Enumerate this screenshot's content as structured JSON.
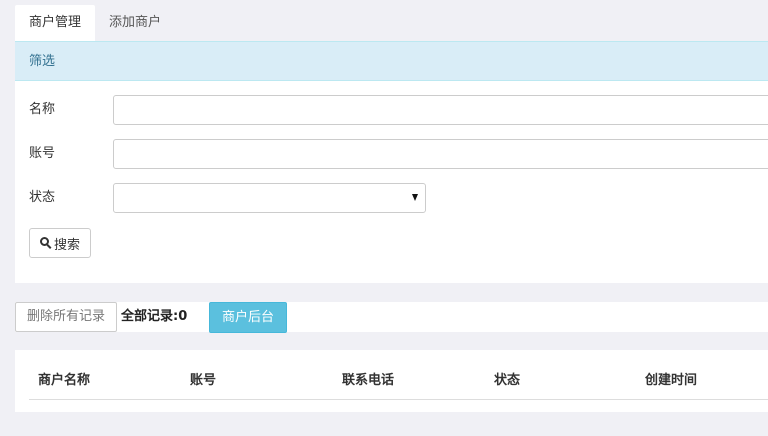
{
  "tabs": [
    {
      "label": "商户管理",
      "active": true
    },
    {
      "label": "添加商户",
      "active": false
    }
  ],
  "filter": {
    "heading": "筛选",
    "fields": {
      "name_label": "名称",
      "name_value": "",
      "account_label": "账号",
      "account_value": "",
      "status_label": "状态",
      "status_value": ""
    },
    "search_label": "搜索",
    "search_icon": "search-icon"
  },
  "actions": {
    "delete_all_label": "删除所有记录",
    "record_count_text": "全部记录:0",
    "merchant_backend_label": "商户后台"
  },
  "table": {
    "columns": [
      "商户名称",
      "账号",
      "联系电话",
      "状态",
      "创建时间"
    ],
    "rows": []
  },
  "colors": {
    "page_bg": "#f0f0f5",
    "heading_bg": "#d9edf7",
    "heading_text": "#31708f",
    "info_button": "#5bc0de"
  }
}
